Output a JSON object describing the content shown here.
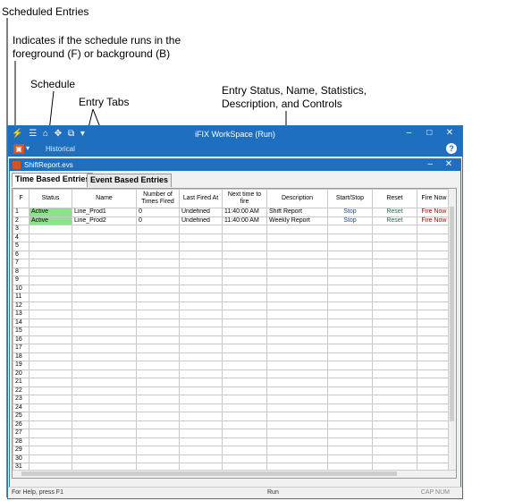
{
  "callouts": {
    "scheduled_entries": "Scheduled Entries",
    "indicates_line1": "Indicates if the schedule runs in the",
    "indicates_line2": "foreground (F) or background (B)",
    "schedule": "Schedule",
    "entry_tabs": "Entry Tabs",
    "entry_status_line1": "Entry Status, Name, Statistics,",
    "entry_status_line2": "Description, and Controls"
  },
  "window": {
    "title": "iFIX WorkSpace (Run)",
    "minimize": "–",
    "maximize": "□",
    "close": "✕",
    "ribbon_tab": "Historical",
    "help": "?"
  },
  "child": {
    "title": "ShiftReport.evs",
    "minimize": "–",
    "close": "✕"
  },
  "tabs": [
    "Time Based Entries",
    "Event Based Entries"
  ],
  "grid": {
    "headers": [
      "F",
      "Status",
      "Name",
      "Number of Times Fired",
      "Last Fired At",
      "Next time to fire",
      "Description",
      "Start/Stop",
      "Reset",
      "Fire Now"
    ],
    "rows": [
      {
        "n": "1",
        "status": "Active",
        "name": "Line_Prod1",
        "times": "0",
        "last": "Undefined",
        "next": "11:40:00 AM",
        "desc": "Shift Report",
        "ss": "Stop",
        "reset": "Reset",
        "fire": "Fire Now"
      },
      {
        "n": "2",
        "status": "Active",
        "name": "Line_Prod2",
        "times": "0",
        "last": "Undefined",
        "next": "11:40:00 AM",
        "desc": "Weekly Report",
        "ss": "Stop",
        "reset": "Reset",
        "fire": "Fire Now"
      }
    ],
    "empty_row_numbers": [
      "3",
      "4",
      "5",
      "6",
      "7",
      "8",
      "9",
      "10",
      "11",
      "12",
      "13",
      "14",
      "15",
      "16",
      "17",
      "18",
      "19",
      "20",
      "21",
      "22",
      "23",
      "24",
      "25",
      "26",
      "27",
      "28",
      "29",
      "30",
      "31"
    ]
  },
  "statusbar": {
    "left": "For Help, press F1",
    "middle": "Run",
    "right": "CAP  NUM"
  }
}
